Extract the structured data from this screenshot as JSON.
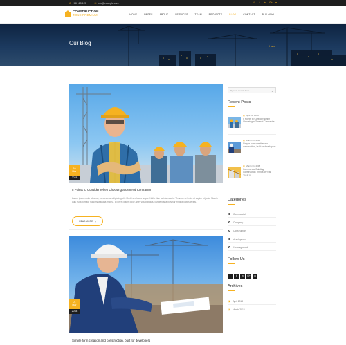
{
  "topbar": {
    "phone": "+88 125 125",
    "email": "info@example.com",
    "phone_icon": "phone-icon",
    "email_icon": "envelope-icon",
    "social": [
      {
        "name": "facebook-icon",
        "glyph": "f"
      },
      {
        "name": "twitter-icon",
        "glyph": "t"
      },
      {
        "name": "linkedin-icon",
        "glyph": "in"
      },
      {
        "name": "google-plus-icon",
        "glyph": "G+"
      },
      {
        "name": "instagram-icon",
        "glyph": "◘"
      }
    ]
  },
  "header": {
    "logo_line1": "CONSTRUCTION",
    "logo_line2": "ZONE PREMIUM",
    "menu": [
      {
        "label": "HOME",
        "active": false
      },
      {
        "label": "PAGES",
        "active": false
      },
      {
        "label": "ABOUT",
        "active": false
      },
      {
        "label": "SERVICES",
        "active": false
      },
      {
        "label": "TEAM",
        "active": false
      },
      {
        "label": "PROJECTS",
        "active": false
      },
      {
        "label": "BLOG",
        "active": true
      },
      {
        "label": "CONTACT",
        "active": false
      },
      {
        "label": "BUY NOW",
        "active": false
      }
    ]
  },
  "hero": {
    "title": "Our Blog",
    "breadcrumb": "Home"
  },
  "posts": [
    {
      "day": "10",
      "month": "Mar",
      "year": "2018",
      "title": "5 Points to Consider When Choosing a General Contractor",
      "excerpt": "Lorem ipsum dolor sit amet, consectetur adipiscing elit. Morbi sed lacus neque. Nulla vitae lacinia mauris. Vivamus vel enim ut sapien ut justo. Mauris quis nulla porttitor nunc malesuada magna, at lorem ipsum dolor amet volutpat quis. Suspendisse pulvinar fringilla luctus lectus.",
      "read_more": "READ MORE"
    },
    {
      "day": "01",
      "month": "Mar",
      "year": "2018",
      "title": "Simple form creation and construction, built for developers"
    }
  ],
  "sidebar": {
    "search_placeholder": "Type to search here...",
    "recent_title": "Recent Posts",
    "recent": [
      {
        "date": "April 10, 2018",
        "title": "5 Points to Consider When Choosing a General Contractor"
      },
      {
        "date": "March 01, 2018",
        "title": "Simple form creation and construction, built for developers"
      },
      {
        "date": "March 01, 2018",
        "title": "Commercial Building Construction Trends of Year 2018-19"
      }
    ],
    "categories_title": "Categories",
    "categories": [
      "Commercial",
      "Company",
      "Construction",
      "development",
      "Uncategorized"
    ],
    "follow_title": "Follow Us",
    "follow": [
      {
        "name": "facebook-icon",
        "glyph": "f"
      },
      {
        "name": "twitter-icon",
        "glyph": "t"
      },
      {
        "name": "linkedin-icon",
        "glyph": "in"
      },
      {
        "name": "google-plus-icon",
        "glyph": "G+"
      },
      {
        "name": "instagram-icon",
        "glyph": "◘"
      }
    ],
    "archives_title": "Archives",
    "archives": [
      "April 2018",
      "March 2018"
    ]
  },
  "colors": {
    "accent": "#f6b221",
    "dark": "#1e1e1e",
    "hero": "#0e2340"
  }
}
